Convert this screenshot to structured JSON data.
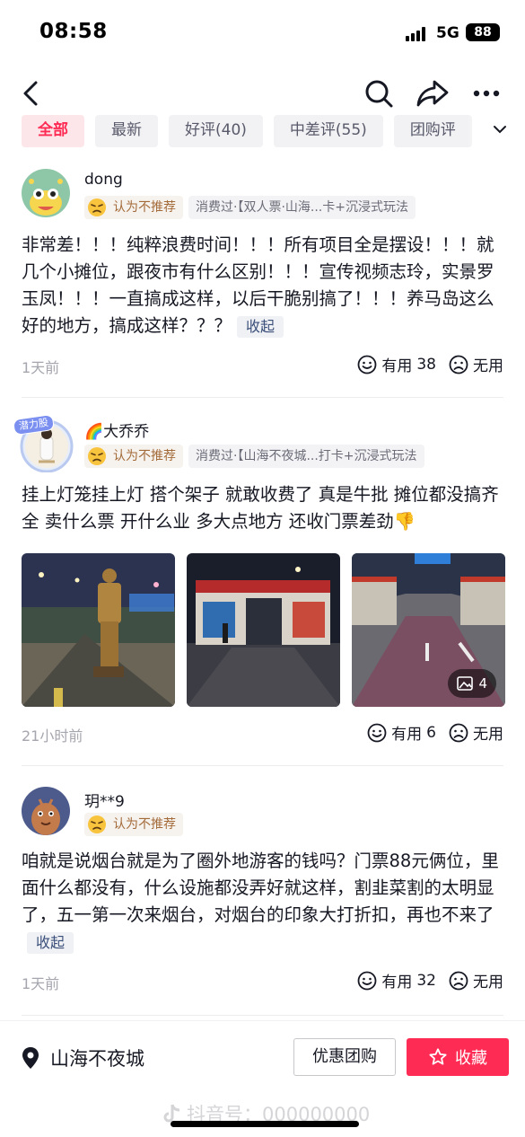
{
  "status_bar": {
    "time": "08:58",
    "network": "5G",
    "battery": "88"
  },
  "nav": {
    "icons": [
      "back-icon",
      "search-icon",
      "share-icon",
      "more-icon"
    ]
  },
  "filters": [
    {
      "label": "全部",
      "active": true
    },
    {
      "label": "最新",
      "active": false
    },
    {
      "label": "好评(40)",
      "active": false
    },
    {
      "label": "中差评(55)",
      "active": false
    },
    {
      "label": "团购评",
      "active": false
    }
  ],
  "reviews": [
    {
      "user": "dong",
      "verdict": "认为不推荐",
      "consumed": "消费过·【双人票·山海...卡+沉浸式玩法",
      "text": "非常差！！！纯粹浪费时间！！！所有项目全是摆设！！！就几个小摊位，跟夜市有什么区别！！！宣传视频志玲，实景罗玉凤！！！一直搞成这样，以后干脆别搞了！！！养马岛这么好的地方，搞成这样？？？",
      "collapse_label": "收起",
      "time": "1天前",
      "useful_label": "有用",
      "useful_count": "38",
      "useless_label": "无用"
    },
    {
      "user": "🌈大乔乔",
      "avatar_badge": "潜力股",
      "verdict": "认为不推荐",
      "consumed": "消费过·【山海不夜城...打卡+沉浸式玩法",
      "text": "挂上灯笼挂上灯 搭个架子 就敢收费了 真是牛批 摊位都没搞齐全 卖什么票 开什么业 多大点地方 还收门票差劲👎",
      "photo_count": "4",
      "time": "21小时前",
      "useful_label": "有用",
      "useful_count": "6",
      "useless_label": "无用"
    },
    {
      "user": "玥**9",
      "verdict": "认为不推荐",
      "text": "咱就是说烟台就是为了圈外地游客的钱吗？门票88元俩位，里面什么都没有，什么设施都没弄好就这样，割韭菜割的太明显了，五一第一次来烟台，对烟台的印象大打折扣，再也不来了",
      "collapse_label": "收起",
      "time": "1天前",
      "useful_label": "有用",
      "useful_count": "32",
      "useless_label": "无用"
    }
  ],
  "bottom": {
    "location": "山海不夜城",
    "deal_button": "优惠团购",
    "fav_button": "收藏",
    "watermark": "抖音号：000000000"
  },
  "colors": {
    "accent": "#fe2c55",
    "notrec_text": "#a46b3a",
    "muted": "#a5a6ae"
  }
}
